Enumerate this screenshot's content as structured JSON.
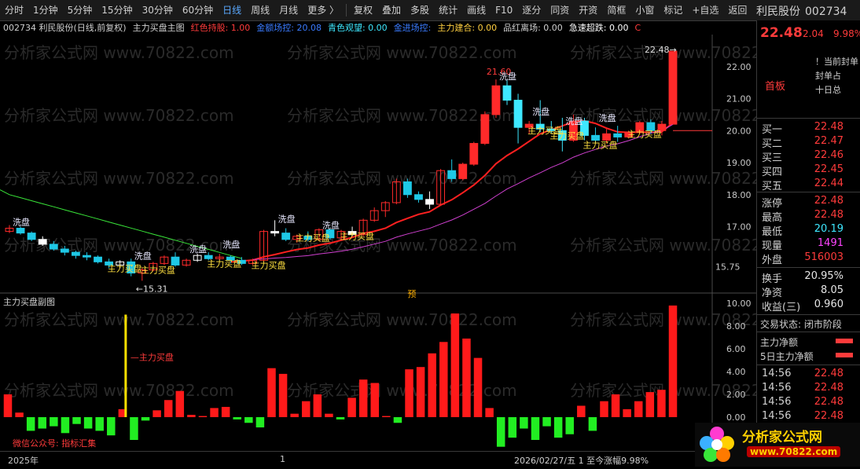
{
  "toolbar": {
    "periods": [
      "分时",
      "1分钟",
      "5分钟",
      "15分钟",
      "30分钟",
      "60分钟",
      "日线",
      "周线",
      "月线",
      "更多 〉"
    ],
    "active_period": "日线",
    "tools": [
      "复权",
      "叠加",
      "多股",
      "统计",
      "画线",
      "F10",
      "逐分",
      "同资",
      "开资",
      "简框",
      "小窗",
      "标记",
      "+自选",
      "返回"
    ]
  },
  "header": {
    "stock_name": "利民股份",
    "stock_code": "002734"
  },
  "legend": {
    "title": "002734  利民股份(日线,前复权)",
    "indicator": "主力买盘主图",
    "items": [
      {
        "label": "红色持股: 1.00",
        "color": "#ff3b3b"
      },
      {
        "label": "金额场控: 20.08",
        "color": "#3a7bff"
      },
      {
        "label": "青色观望: 0.00",
        "color": "#3ee8ff"
      },
      {
        "label": "金进场控: ",
        "color": "#3a7bff"
      },
      {
        "label": "主力建合: 0.00",
        "color": "#ffcf40"
      },
      {
        "label": "品红离场: 0.00",
        "color": "#d0d0d0"
      },
      {
        "label": "急速超跌: 0.00",
        "color": "#ffffff"
      },
      {
        "label": "C",
        "color": "#ff3b3b"
      }
    ]
  },
  "sub_legend": "主力买盘副图",
  "right_panel": {
    "price": "22.48",
    "change": "2.04",
    "pct": "9.98%",
    "notice_lines": [
      "！当前封单",
      "封单占",
      "十日总"
    ],
    "first_board": "首板",
    "bid_rows": [
      {
        "label": "买一",
        "value": "22.48"
      },
      {
        "label": "买二",
        "value": "22.47"
      },
      {
        "label": "买三",
        "value": "22.46"
      },
      {
        "label": "买四",
        "value": "22.45"
      },
      {
        "label": "买五",
        "value": "22.44"
      }
    ],
    "stats": [
      {
        "label": "涨停",
        "value": "22.48",
        "color": "red"
      },
      {
        "label": "最高",
        "value": "22.48",
        "color": "red"
      },
      {
        "label": "最低",
        "value": "20.19",
        "color": "cyan"
      },
      {
        "label": "现量",
        "value": "1491",
        "color": "mag"
      },
      {
        "label": "外盘",
        "value": "516003",
        "color": "red"
      }
    ],
    "stats2": [
      {
        "label": "换手",
        "value": "20.95%",
        "color": "white"
      },
      {
        "label": "净资",
        "value": "8.05",
        "color": "white"
      },
      {
        "label": "收益(三)",
        "value": "0.960",
        "color": "white"
      }
    ],
    "trade_state": "交易状态: 闭市阶段",
    "flows": [
      "主力净额",
      "5日主力净额"
    ],
    "ticks": [
      {
        "time": "14:56",
        "price": "22.48"
      },
      {
        "time": "14:56",
        "price": "22.48"
      },
      {
        "time": "14:56",
        "price": "22.48"
      },
      {
        "time": "14:56",
        "price": "22.48"
      }
    ]
  },
  "bottom": {
    "year": "2025年",
    "mid": "1",
    "date_info": "2026/02/27/五  1  至今涨幅9.98%",
    "wechat": "微信公众号: 指标汇集"
  },
  "logo": {
    "text": "分析家公式网",
    "url": "www.70822.com"
  },
  "watermark": "分析家公式网 www.70822.com",
  "chart_data": [
    {
      "type": "candlestick",
      "title": "主力买盘主图",
      "ylim": [
        15.0,
        23.0
      ],
      "yticks": [
        17.0,
        18.0,
        19.0,
        20.0,
        21.0,
        22.0
      ],
      "y_labels": [
        "17.00",
        "18.00",
        "19.00",
        "20.00",
        "21.00",
        "22.00"
      ],
      "last_close_label": "20.00",
      "low_tag": "15.75",
      "annotations": {
        "high": "21.60",
        "low": "←15.31",
        "last": "22.48→",
        "wash": "洗盘",
        "buy": "主力买盘",
        "pre": "预"
      },
      "candles": [
        {
          "o": 16.85,
          "h": 17.05,
          "l": 16.8,
          "c": 16.95
        },
        {
          "o": 16.95,
          "h": 17.0,
          "l": 16.75,
          "c": 16.8
        },
        {
          "o": 16.8,
          "h": 16.85,
          "l": 16.55,
          "c": 16.6
        },
        {
          "o": 16.6,
          "h": 16.7,
          "l": 16.4,
          "c": 16.45
        },
        {
          "o": 16.45,
          "h": 16.55,
          "l": 16.25,
          "c": 16.3
        },
        {
          "o": 16.3,
          "h": 16.4,
          "l": 16.1,
          "c": 16.2
        },
        {
          "o": 16.2,
          "h": 16.25,
          "l": 16.0,
          "c": 16.1
        },
        {
          "o": 16.1,
          "h": 16.2,
          "l": 15.95,
          "c": 16.05
        },
        {
          "o": 16.05,
          "h": 16.1,
          "l": 15.85,
          "c": 15.9
        },
        {
          "o": 15.9,
          "h": 16.0,
          "l": 15.7,
          "c": 15.8
        },
        {
          "o": 15.8,
          "h": 15.95,
          "l": 15.7,
          "c": 15.9
        },
        {
          "o": 15.9,
          "h": 16.0,
          "l": 15.45,
          "c": 15.55
        },
        {
          "o": 15.55,
          "h": 15.7,
          "l": 15.31,
          "c": 15.65
        },
        {
          "o": 15.65,
          "h": 15.9,
          "l": 15.6,
          "c": 15.85
        },
        {
          "o": 15.85,
          "h": 16.1,
          "l": 15.8,
          "c": 16.05
        },
        {
          "o": 16.05,
          "h": 16.2,
          "l": 15.75,
          "c": 15.8
        },
        {
          "o": 15.8,
          "h": 16.0,
          "l": 15.75,
          "c": 15.95
        },
        {
          "o": 15.95,
          "h": 16.15,
          "l": 15.9,
          "c": 16.1
        },
        {
          "o": 16.1,
          "h": 16.2,
          "l": 15.95,
          "c": 16.0
        },
        {
          "o": 16.0,
          "h": 16.15,
          "l": 15.95,
          "c": 16.05
        },
        {
          "o": 16.05,
          "h": 16.1,
          "l": 15.85,
          "c": 15.95
        },
        {
          "o": 15.95,
          "h": 16.05,
          "l": 15.8,
          "c": 15.85
        },
        {
          "o": 15.85,
          "h": 16.0,
          "l": 15.8,
          "c": 15.95
        },
        {
          "o": 15.95,
          "h": 16.9,
          "l": 15.9,
          "c": 16.85
        },
        {
          "o": 16.85,
          "h": 17.2,
          "l": 16.7,
          "c": 16.8
        },
        {
          "o": 16.8,
          "h": 16.95,
          "l": 16.55,
          "c": 16.6
        },
        {
          "o": 16.6,
          "h": 16.75,
          "l": 16.5,
          "c": 16.7
        },
        {
          "o": 16.7,
          "h": 16.85,
          "l": 16.55,
          "c": 16.6
        },
        {
          "o": 16.6,
          "h": 16.95,
          "l": 16.55,
          "c": 16.9
        },
        {
          "o": 16.9,
          "h": 16.95,
          "l": 16.6,
          "c": 16.65
        },
        {
          "o": 16.65,
          "h": 16.9,
          "l": 16.6,
          "c": 16.85
        },
        {
          "o": 16.85,
          "h": 17.0,
          "l": 16.7,
          "c": 16.75
        },
        {
          "o": 16.75,
          "h": 17.25,
          "l": 16.7,
          "c": 17.2
        },
        {
          "o": 17.2,
          "h": 17.6,
          "l": 17.15,
          "c": 17.5
        },
        {
          "o": 17.5,
          "h": 17.8,
          "l": 17.3,
          "c": 17.75
        },
        {
          "o": 17.75,
          "h": 18.5,
          "l": 17.7,
          "c": 18.4
        },
        {
          "o": 18.4,
          "h": 18.5,
          "l": 17.9,
          "c": 18.0
        },
        {
          "o": 18.0,
          "h": 18.1,
          "l": 17.75,
          "c": 17.85
        },
        {
          "o": 17.85,
          "h": 18.1,
          "l": 17.55,
          "c": 17.7
        },
        {
          "o": 17.7,
          "h": 18.8,
          "l": 17.65,
          "c": 18.75
        },
        {
          "o": 18.75,
          "h": 19.1,
          "l": 18.4,
          "c": 18.5
        },
        {
          "o": 18.5,
          "h": 19.0,
          "l": 18.45,
          "c": 18.95
        },
        {
          "o": 18.95,
          "h": 19.65,
          "l": 18.9,
          "c": 19.6
        },
        {
          "o": 19.6,
          "h": 20.6,
          "l": 19.55,
          "c": 20.5
        },
        {
          "o": 20.5,
          "h": 21.6,
          "l": 20.4,
          "c": 21.4
        },
        {
          "o": 21.4,
          "h": 21.6,
          "l": 20.8,
          "c": 20.95
        },
        {
          "o": 20.95,
          "h": 21.15,
          "l": 19.6,
          "c": 20.1
        },
        {
          "o": 20.1,
          "h": 20.3,
          "l": 19.9,
          "c": 20.2
        },
        {
          "o": 20.2,
          "h": 20.95,
          "l": 19.95,
          "c": 20.05
        },
        {
          "o": 20.05,
          "h": 20.3,
          "l": 19.9,
          "c": 20.0
        },
        {
          "o": 20.0,
          "h": 20.4,
          "l": 19.35,
          "c": 19.7
        },
        {
          "o": 19.7,
          "h": 20.5,
          "l": 19.65,
          "c": 20.3
        },
        {
          "o": 20.3,
          "h": 20.4,
          "l": 19.7,
          "c": 19.85
        },
        {
          "o": 19.85,
          "h": 20.1,
          "l": 19.6,
          "c": 19.7
        },
        {
          "o": 19.7,
          "h": 20.05,
          "l": 19.6,
          "c": 19.9
        },
        {
          "o": 19.9,
          "h": 20.15,
          "l": 19.65,
          "c": 19.8
        },
        {
          "o": 19.8,
          "h": 20.0,
          "l": 19.75,
          "c": 19.95
        },
        {
          "o": 19.95,
          "h": 20.3,
          "l": 19.9,
          "c": 20.25
        },
        {
          "o": 20.25,
          "h": 20.35,
          "l": 19.9,
          "c": 20.0
        },
        {
          "o": 20.0,
          "h": 20.3,
          "l": 19.85,
          "c": 20.2
        },
        {
          "o": 20.2,
          "h": 22.48,
          "l": 20.19,
          "c": 22.48
        }
      ]
    },
    {
      "type": "bar",
      "title": "主力买盘副图",
      "ylim": [
        -2.0,
        10.0
      ],
      "y_labels": [
        "0.00",
        "2.00",
        "4.00",
        "6.00",
        "8.00",
        "10.00"
      ],
      "annotation": "主力买盘",
      "values": [
        2.0,
        0.4,
        -1.2,
        -1.0,
        -0.8,
        -1.4,
        -0.6,
        -1.0,
        -1.2,
        -1.6,
        0.7,
        -2.0,
        -0.3,
        0.6,
        1.5,
        2.3,
        0.2,
        0.1,
        0.8,
        0.9,
        -0.2,
        -0.5,
        -0.9,
        4.3,
        3.8,
        0.3,
        1.4,
        2.0,
        0.3,
        -0.2,
        1.7,
        3.3,
        3.0,
        0.1,
        -0.5,
        4.2,
        4.4,
        5.6,
        6.6,
        9.1,
        6.9,
        5.2,
        0.8,
        -2.6,
        -1.8,
        -1.0,
        -2.0,
        -0.8,
        -1.8,
        -1.5,
        1.0,
        -1.2,
        1.4,
        2.0,
        0.7,
        1.4,
        2.2,
        2.4,
        9.8
      ]
    }
  ]
}
